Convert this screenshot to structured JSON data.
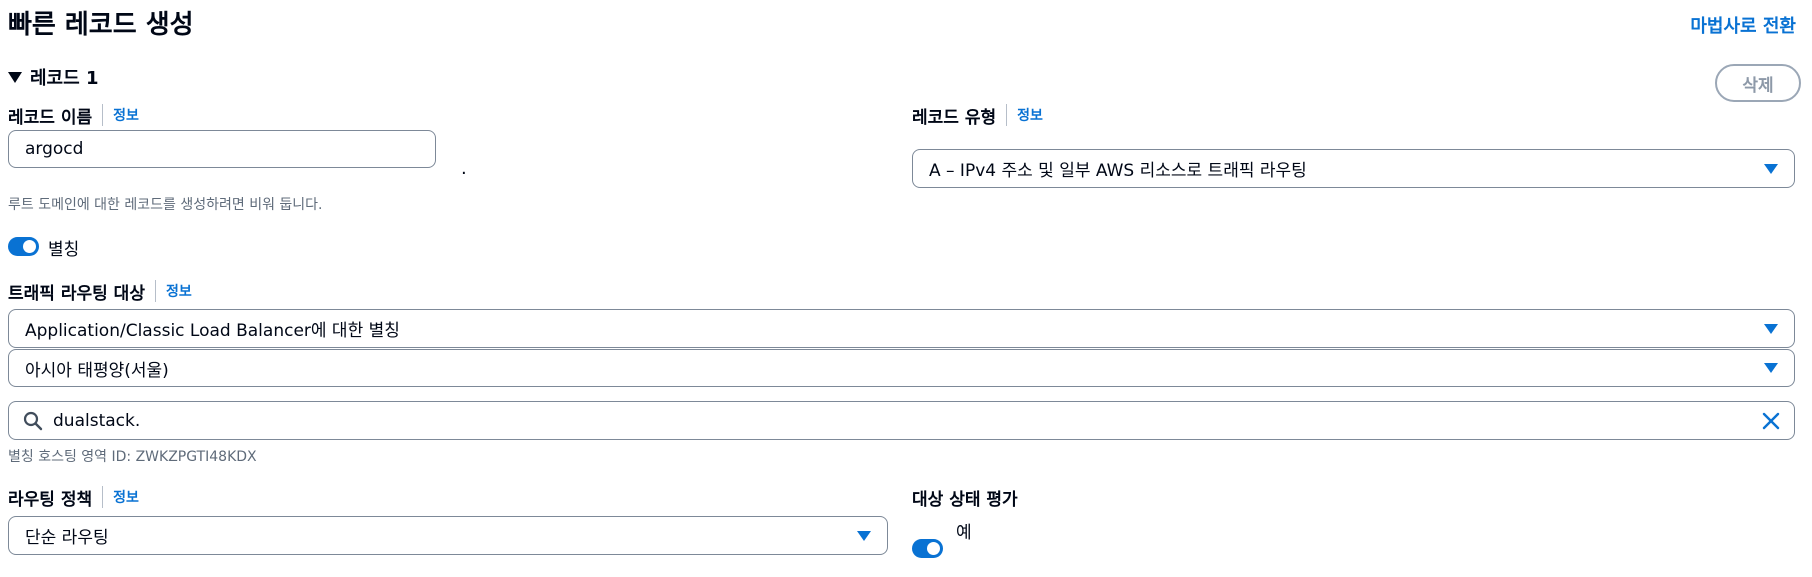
{
  "header": {
    "title": "빠른 레코드 생성",
    "wizard_link": "마법사로 전환"
  },
  "record": {
    "heading": "레코드 1",
    "delete_label": "삭제",
    "name": {
      "label": "레코드 이름",
      "info": "정보",
      "value": "argocd",
      "domain_suffix": ".",
      "hint": "루트 도메인에 대한 레코드를 생성하려면 비워 둡니다."
    },
    "type": {
      "label": "레코드 유형",
      "info": "정보",
      "value": "A – IPv4 주소 및 일부 AWS 리소스로 트래픽 라우팅"
    },
    "alias": {
      "label": "별칭",
      "enabled": true
    },
    "target": {
      "label": "트래픽 라우팅 대상",
      "info": "정보",
      "endpoint_value": "Application/Classic Load Balancer에 대한 별칭",
      "region_value": "아시아 태평양(서울)",
      "search_value": "dualstack.",
      "hosted_zone_hint": "별칭 호스팅 영역 ID: ZWKZPGTI48KDX"
    },
    "routing_policy": {
      "label": "라우팅 정책",
      "info": "정보",
      "value": "단순 라우팅"
    },
    "health": {
      "label": "대상 상태 평가",
      "toggle_label": "예",
      "enabled": true
    }
  },
  "icons": {
    "search": "search-icon",
    "clear": "close-icon",
    "dropdown": "caret-down-icon",
    "expand": "caret-down-icon"
  },
  "colors": {
    "accent": "#0972d3",
    "text": "#000716",
    "muted": "#5f6b7a",
    "border": "#7d8998"
  }
}
